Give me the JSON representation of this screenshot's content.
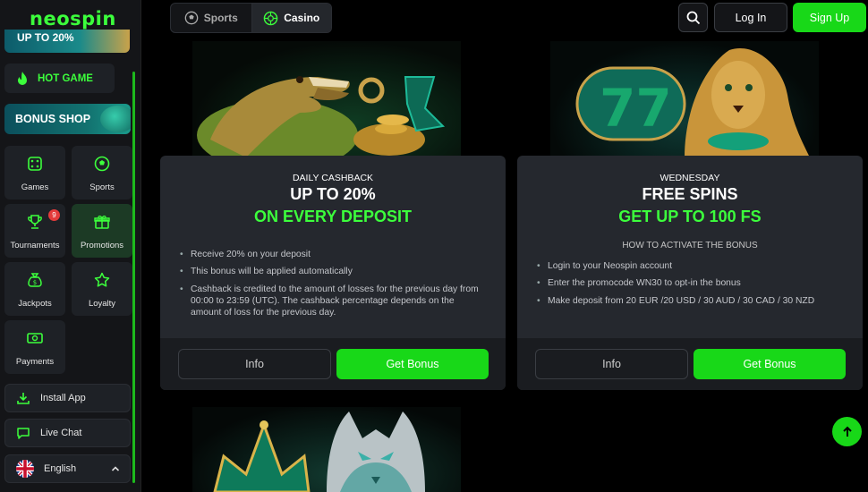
{
  "brand": {
    "logo": "neospin",
    "accent": "#3cff3c",
    "button_green": "#18d818"
  },
  "sidebar": {
    "promo_banner": "UP TO 20%",
    "hot_game": {
      "label": "HOT GAME",
      "icon": "flame-icon"
    },
    "bonus_shop": {
      "label": "BONUS SHOP"
    },
    "tiles": [
      {
        "label": "Games",
        "icon": "dice-icon"
      },
      {
        "label": "Sports",
        "icon": "soccer-ball-icon"
      },
      {
        "label": "Tournaments",
        "icon": "trophy-icon",
        "badge": "9"
      },
      {
        "label": "Promotions",
        "icon": "gift-icon",
        "active": true
      },
      {
        "label": "Jackpots",
        "icon": "money-bag-icon"
      },
      {
        "label": "Loyalty",
        "icon": "star-icon"
      },
      {
        "label": "Payments",
        "icon": "cash-icon"
      }
    ],
    "install_app": "Install App",
    "live_chat": "Live Chat",
    "language": "English"
  },
  "header": {
    "tabs": [
      {
        "label": "Sports",
        "icon": "soccer-ball-icon"
      },
      {
        "label": "Casino",
        "icon": "roulette-icon",
        "active": true
      }
    ],
    "login": "Log In",
    "signup": "Sign Up"
  },
  "cards": [
    {
      "kicker": "DAILY CASHBACK",
      "headline": "UP TO 20%",
      "accent": "ON EVERY DEPOSIT",
      "howto": "",
      "bullets": [
        "Receive 20% on your deposit",
        "This bonus will be applied automatically",
        "Cashback is credited to the amount of losses for the previous day from 00:00 to 23:59 (UTC). The cashback percentage depends on the amount of loss for the previous day."
      ],
      "info": "Info",
      "get": "Get Bonus"
    },
    {
      "kicker": "WEDNESDAY",
      "headline": "FREE SPINS",
      "accent": "GET UP TO 100 FS",
      "howto": "HOW TO ACTIVATE THE BONUS",
      "bullets": [
        "Login to your Neospin account",
        "Enter the promocode WN30 to opt-in the bonus",
        "Make deposit from 20 EUR /20 USD / 30 AUD / 30 CAD / 30 NZD"
      ],
      "info": "Info",
      "get": "Get Bonus"
    }
  ]
}
